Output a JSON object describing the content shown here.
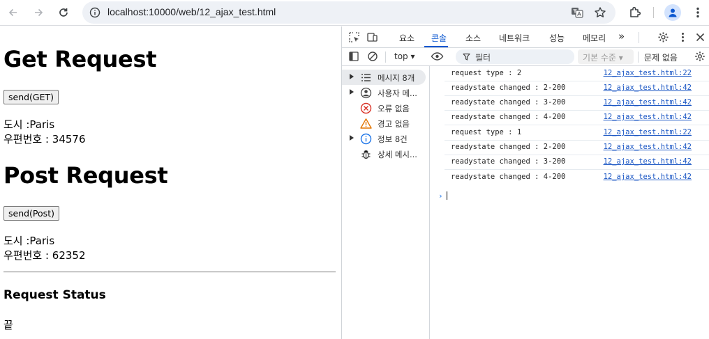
{
  "browser": {
    "url": "localhost:10000/web/12_ajax_test.html",
    "accent_color": "#0b57d0"
  },
  "page": {
    "get_heading": "Get Request",
    "get_button": "send(GET)",
    "get_city": "도시 :Paris",
    "get_zip": "우편번호 : 34576",
    "post_heading": "Post Request",
    "post_button": "send(Post)",
    "post_city": "도시 :Paris",
    "post_zip": "우편번호 : 62352",
    "status_heading": "Request Status",
    "status_text": "끝"
  },
  "devtools": {
    "tabs": [
      "요소",
      "콘솔",
      "소스",
      "네트워크",
      "성능",
      "메모리"
    ],
    "active_tab": "콘솔",
    "more_tabs": "»",
    "context": "top ▾",
    "filter_placeholder": "필터",
    "level": "기본 수준 ▾",
    "issues": "문제 없음",
    "sidebar": [
      {
        "label": "메시지 8개",
        "icon": "list-icon",
        "expandable": true,
        "selected": true
      },
      {
        "label": "사용자 메...",
        "icon": "user-icon",
        "expandable": true,
        "selected": false
      },
      {
        "label": "오류 없음",
        "icon": "error-icon",
        "expandable": false,
        "selected": false
      },
      {
        "label": "경고 없음",
        "icon": "warning-icon",
        "expandable": false,
        "selected": false
      },
      {
        "label": "정보 8건",
        "icon": "info-icon",
        "expandable": true,
        "selected": false
      },
      {
        "label": "상세 메시...",
        "icon": "bug-icon",
        "expandable": false,
        "selected": false
      }
    ],
    "logs": [
      {
        "message": "request type : 2",
        "source": "12_ajax_test.html:22"
      },
      {
        "message": "readystate changed : 2-200",
        "source": "12_ajax_test.html:42"
      },
      {
        "message": "readystate changed : 3-200",
        "source": "12_ajax_test.html:42"
      },
      {
        "message": "readystate changed : 4-200",
        "source": "12_ajax_test.html:42"
      },
      {
        "message": "request type : 1",
        "source": "12_ajax_test.html:22"
      },
      {
        "message": "readystate changed : 2-200",
        "source": "12_ajax_test.html:42"
      },
      {
        "message": "readystate changed : 3-200",
        "source": "12_ajax_test.html:42"
      },
      {
        "message": "readystate changed : 4-200",
        "source": "12_ajax_test.html:42"
      }
    ],
    "prompt": "›"
  }
}
